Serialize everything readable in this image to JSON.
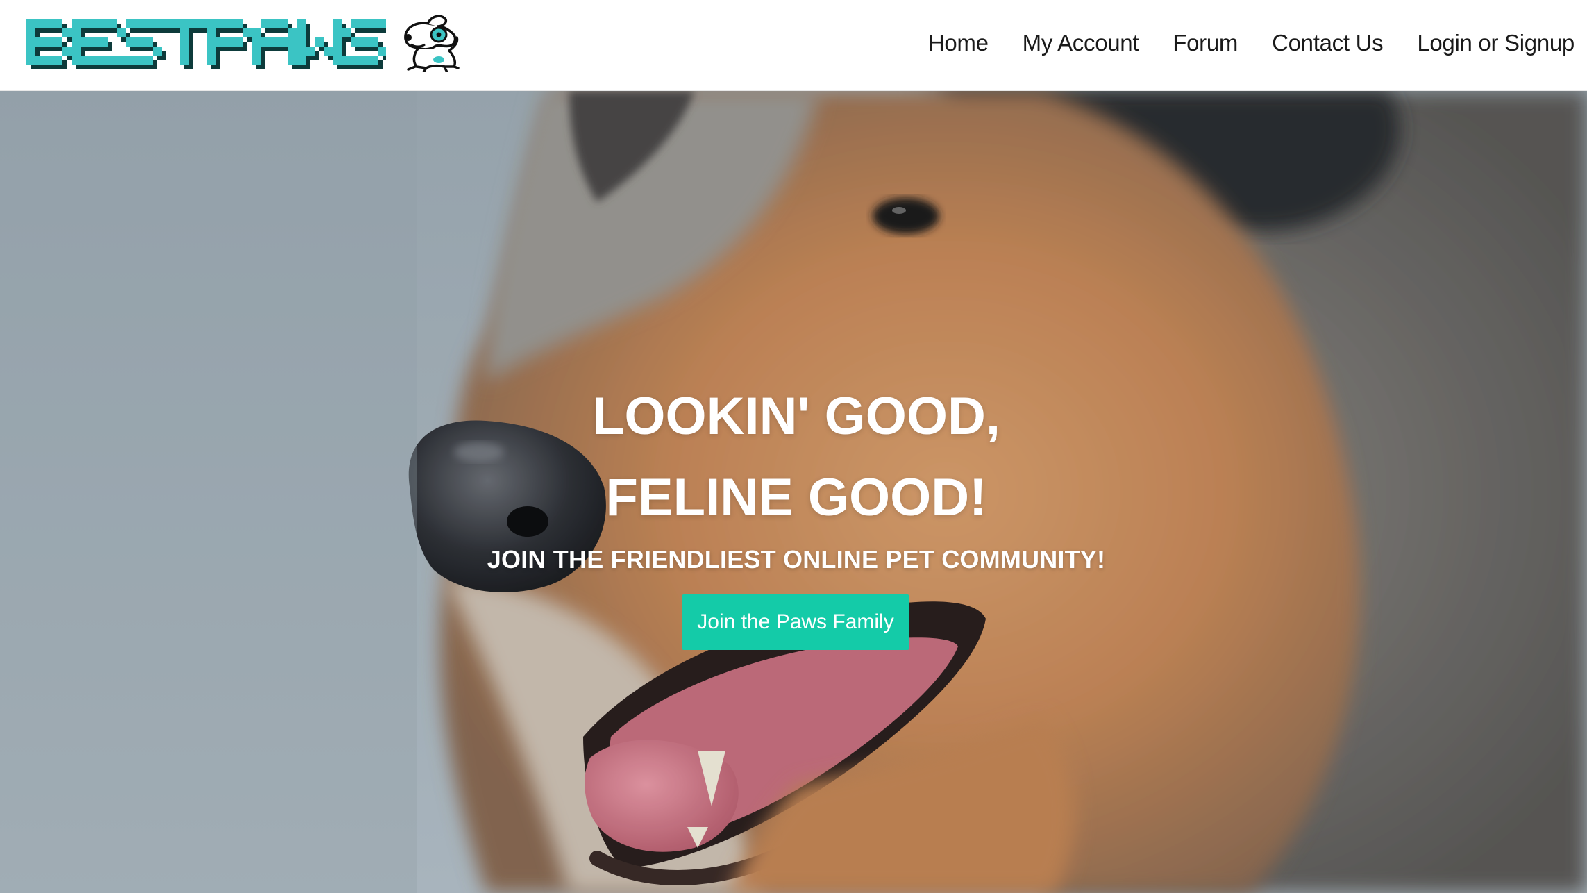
{
  "header": {
    "logo_text": "BESTPAWS",
    "logo_mascot_icon": "cartoon-dog-icon",
    "brand_colors": {
      "logo_face": "#3bc4c4",
      "logo_shadow": "#0d3b3b",
      "accent": "#14cba8"
    },
    "nav": [
      {
        "label": "Home"
      },
      {
        "label": "My Account"
      },
      {
        "label": "Forum"
      },
      {
        "label": "Contact Us"
      },
      {
        "label": "Login or Signup"
      }
    ]
  },
  "hero": {
    "background_image": "rough-collie-close-up-photo",
    "headline_line1": "LOOKIN' GOOD,",
    "headline_line2": "FELINE GOOD!",
    "subheadline": "JOIN THE FRIENDLIEST ONLINE PET COMMUNITY!",
    "cta_label": "Join the Paws Family"
  }
}
